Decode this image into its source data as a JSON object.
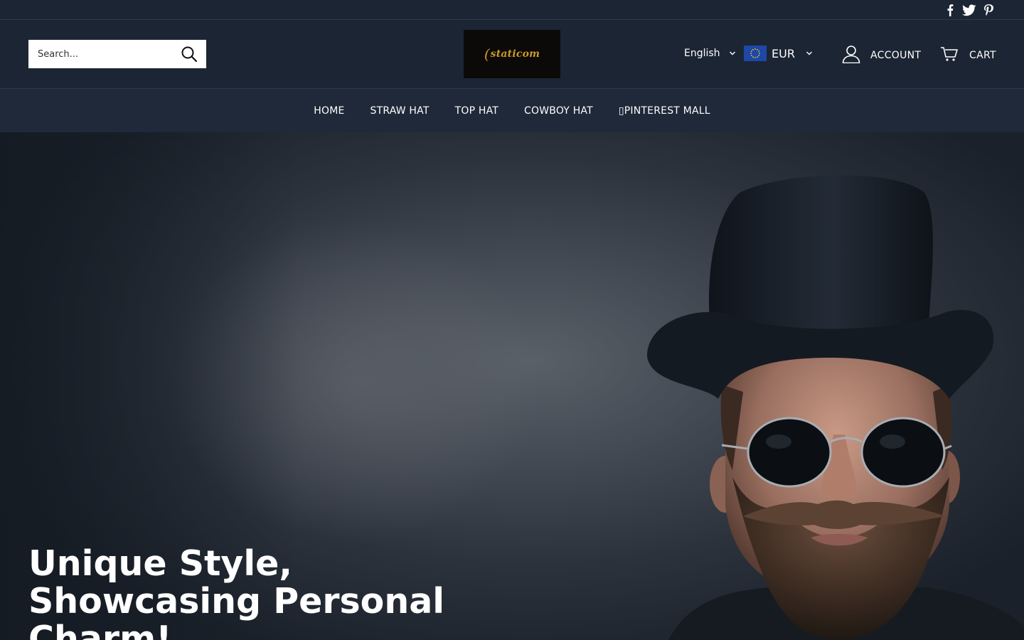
{
  "topbar": {
    "social": [
      {
        "icon": "facebook-icon"
      },
      {
        "icon": "twitter-icon"
      },
      {
        "icon": "pinterest-icon"
      }
    ]
  },
  "header": {
    "search_placeholder": "Search...",
    "logo_text": "staticom",
    "language": "English",
    "currency": "EUR",
    "account_label": "ACCOUNT",
    "cart_label": "CART"
  },
  "nav": {
    "items": [
      {
        "label": "HOME"
      },
      {
        "label": "STRAW HAT"
      },
      {
        "label": "TOP HAT"
      },
      {
        "label": "COWBOY HAT"
      },
      {
        "label": "PINTEREST MALL"
      }
    ]
  },
  "hero": {
    "title": "Unique Style, Showcasing Personal Charm!"
  },
  "colors": {
    "header_bg": "#1c2533",
    "nav_bg": "#1f2939",
    "logo_gold": "#c99a2a",
    "flag_blue": "#1d47a8"
  }
}
